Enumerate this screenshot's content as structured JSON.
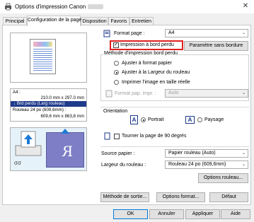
{
  "window": {
    "title": "Options d'impression Canon"
  },
  "tabs": [
    {
      "label": "Principal"
    },
    {
      "label": "Configuration de la page"
    },
    {
      "label": "Disposition"
    },
    {
      "label": "Favoris"
    },
    {
      "label": "Entretien"
    }
  ],
  "preview_info": {
    "size_label": "A4 :",
    "size_value": "210.0 mm x 297.0 mm",
    "borderless_mode": "Brd perdu (Larg rouleau)",
    "roll_label": "Rouleau 24 po (609,6mm) :",
    "roll_value": "609,6 mm x 863,8 mm"
  },
  "format_page": {
    "label": "Format page :",
    "value": "A4"
  },
  "borderless": {
    "checkbox_label": "Impression à bord perdu",
    "checked": true,
    "settings_button": "Paramètre sans bordure"
  },
  "borderless_method": {
    "group_label": "Méthode d'impression bord perdu",
    "options": [
      {
        "label": "Ajuster à format papier",
        "selected": false
      },
      {
        "label": "Ajuster à la Largeur du rouleau",
        "selected": true
      },
      {
        "label": "Imprimer l'image en taille réelle",
        "selected": false
      }
    ],
    "format_label": "Format pap. impr. :",
    "format_value": "Auto"
  },
  "orientation": {
    "group_label": "Orientation",
    "portrait_label": "Portrait",
    "landscape_label": "Paysage",
    "portrait_selected": true,
    "rotate_label": "Tourner la page de 90 degrés",
    "rotate_checked": false
  },
  "paper_source": {
    "label": "Source papier :",
    "value": "Papier rouleau (Auto)"
  },
  "roll_width": {
    "label": "Largeur du rouleau :",
    "value": "Rouleau 24 po (609,6mm)",
    "options_button": "Options rouleau..."
  },
  "panel_buttons": {
    "output_method": "Méthode de sortie...",
    "format_options": "Options format...",
    "defaults": "Défaut"
  },
  "dialog_buttons": {
    "ok": "OK",
    "cancel": "Annuler",
    "apply": "Appliquer",
    "help": "Aide"
  },
  "colors": {
    "accent": "#1e3a8a",
    "highlight_red": "#e02020",
    "orient_bg": "#e6f2fa",
    "arrow_blue": "#1f7ad4"
  }
}
